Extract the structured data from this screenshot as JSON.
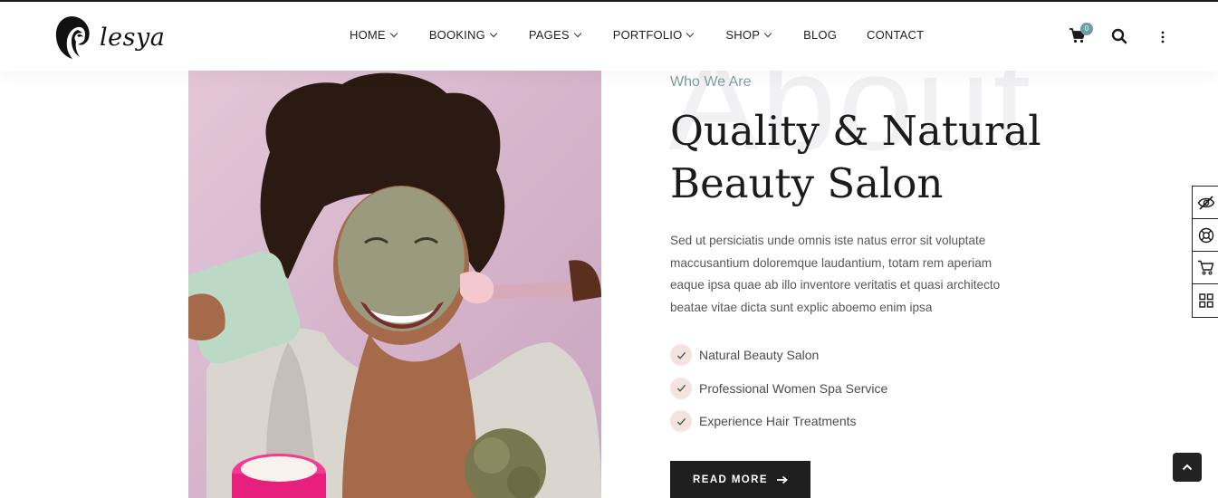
{
  "brand": {
    "name": "lesya"
  },
  "nav": [
    {
      "label": "HOME",
      "dropdown": true
    },
    {
      "label": "BOOKING",
      "dropdown": true
    },
    {
      "label": "PAGES",
      "dropdown": true
    },
    {
      "label": "PORTFOLIO",
      "dropdown": true
    },
    {
      "label": "SHOP",
      "dropdown": true
    },
    {
      "label": "BLOG",
      "dropdown": false
    },
    {
      "label": "CONTACT",
      "dropdown": false
    }
  ],
  "header_actions": {
    "cart_count": "0",
    "icons": [
      "cart-icon",
      "search-icon",
      "more-vertical-icon"
    ]
  },
  "about": {
    "watermark": "About",
    "eyebrow": "Who We Are",
    "title": "Quality & Natural Beauty Salon",
    "paragraph": "Sed ut persiciatis unde omnis iste natus error sit voluptate maccusantium doloremque laudantium, totam rem aperiam eaque ipsa quae ab illo inventore veritatis et quasi architecto beatae vitae dicta sunt explic aboemo enim ipsa",
    "features": [
      "Natural Beauty Salon",
      "Professional Women Spa Service",
      "Experience Hair Treatments"
    ],
    "button_label": "READ MORE"
  },
  "side_tools": [
    "eye-off-icon",
    "support-icon",
    "cart-icon",
    "grid-icon"
  ],
  "colors": {
    "accent": "#7c9da6",
    "check_bg": "#f4e4e0",
    "dark": "#1f1f1f",
    "photo_bg": "#d9bcd0"
  }
}
